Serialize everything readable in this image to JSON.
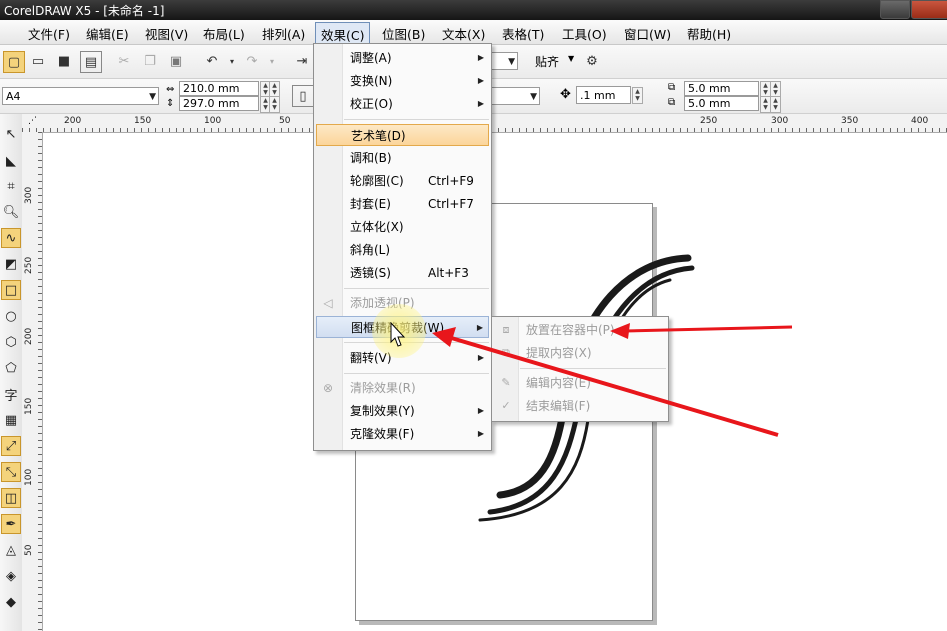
{
  "window": {
    "title": "CorelDRAW X5 - [未命名 -1]"
  },
  "menubar": {
    "items": [
      "文件(F)",
      "编辑(E)",
      "视图(V)",
      "布局(L)",
      "排列(A)",
      "效果(C)",
      "位图(B)",
      "文本(X)",
      "表格(T)",
      "工具(O)",
      "窗口(W)",
      "帮助(H)"
    ]
  },
  "toolbar": {
    "snap_label": "贴齐"
  },
  "property_bar": {
    "page_size": "A4",
    "width": "210.0 mm",
    "height": "297.0 mm",
    "nudge": ".1 mm",
    "dup_x": "5.0 mm",
    "dup_y": "5.0 mm"
  },
  "ruler_top": {
    "labels": [
      "200",
      "150",
      "100",
      "50",
      "250",
      "300",
      "350",
      "400"
    ]
  },
  "ruler_left": {
    "labels": [
      "300",
      "250",
      "200",
      "150",
      "100",
      "50"
    ]
  },
  "toolbox": {
    "text_tool_glyph": "字"
  },
  "effects_menu": {
    "adjust": "调整(A)",
    "transform": "变换(N)",
    "correction": "校正(O)",
    "artistic_media": "艺术笔(D)",
    "blend": "调和(B)",
    "contour": "轮廓图(C)",
    "contour_shortcut": "Ctrl+F9",
    "envelope": "封套(E)",
    "envelope_shortcut": "Ctrl+F7",
    "extrude": "立体化(X)",
    "bevel": "斜角(L)",
    "lens": "透镜(S)",
    "lens_shortcut": "Alt+F3",
    "add_perspective": "添加透视(P)",
    "powerclip": "图框精确剪裁(W)",
    "flip": "翻转(V)",
    "clear_effect": "清除效果(R)",
    "copy_effect": "复制效果(Y)",
    "clone_effect": "克隆效果(F)"
  },
  "powerclip_menu": {
    "place_inside": "放置在容器中(P)",
    "extract_contents": "提取内容(X)",
    "edit_contents": "编辑内容(E)",
    "finish_editing": "结束编辑(F)"
  },
  "colors": {
    "annotation_arrow": "#e8161b",
    "menu_highlight": "#fbd59a",
    "cursor_halo": "#fff27a"
  }
}
